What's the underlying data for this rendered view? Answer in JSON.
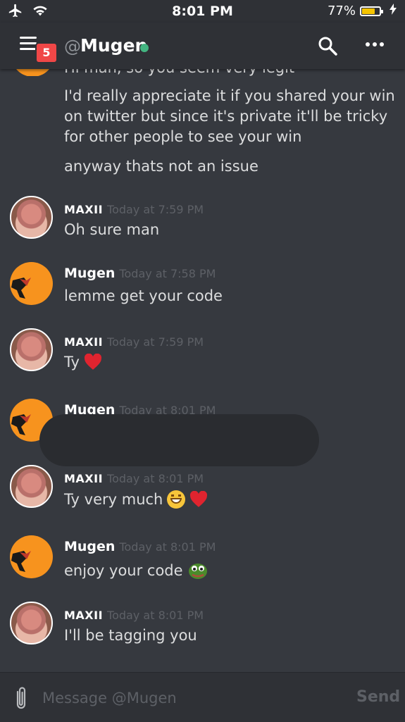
{
  "status_bar": {
    "time": "8:01 PM",
    "battery_percent": "77%",
    "battery_level": 0.77,
    "icons": [
      "airplane-icon",
      "wifi-icon",
      "battery-icon",
      "charging-icon"
    ]
  },
  "header": {
    "menu_badge": "5",
    "at_symbol": "@",
    "title": "Mugen",
    "online_status_color": "#43b581",
    "icons": [
      "menu-icon",
      "search-icon",
      "more-icon"
    ]
  },
  "messages": {
    "cut_line": "Hi man, so you seem very legit",
    "cont": [
      "I'd really appreciate it if you shared your win on twitter but since it's private it'll be tricky for other people to see your win",
      "anyway thats not an issue"
    ],
    "groups": [
      {
        "author": "MAXII",
        "time": "Today at 7:59 PM",
        "text": "Oh sure man"
      },
      {
        "author": "Mugen",
        "time": "Today at 7:58 PM",
        "text": "lemme get your code"
      },
      {
        "author": "MAXII",
        "time": "Today at 7:59 PM",
        "text": "Ty"
      },
      {
        "author": "Mugen",
        "time": "Today at 8:01 PM",
        "text": ""
      },
      {
        "author": "MAXII",
        "time": "Today at 8:01 PM",
        "text": "Ty very much"
      },
      {
        "author": "Mugen",
        "time": "Today at 8:01 PM",
        "text": "enjoy your code"
      },
      {
        "author": "MAXII",
        "time": "Today at 8:01 PM",
        "text": "I'll be tagging you"
      }
    ]
  },
  "composer": {
    "placeholder": "Message @Mugen",
    "send_label": "Send"
  },
  "colors": {
    "background": "#36393f",
    "bar": "#2f3136",
    "badge": "#f04747",
    "mugen_avatar": "#f7931e"
  }
}
